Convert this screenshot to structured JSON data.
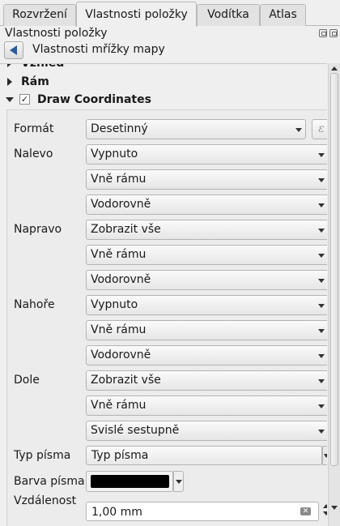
{
  "tabs": [
    {
      "label": "Rozvržení"
    },
    {
      "label": "Vlastnosti položky"
    },
    {
      "label": "Vodítka"
    },
    {
      "label": "Atlas"
    }
  ],
  "panel": {
    "title": "Vlastnosti položky",
    "back_label": "Vlastnosti mřížky mapy"
  },
  "groups": {
    "partial_label": "Vzhled",
    "frame_label": "Rám",
    "draw_coords_label": "Draw Coordinates",
    "draw_coords_checked": true,
    "checkmark": "✓"
  },
  "form": {
    "format_label": "Formát",
    "format_value": "Desetinný",
    "expression_symbol": "ε",
    "left_label": "Nalevo",
    "left_show": "Vypnuto",
    "left_position": "Vně rámu",
    "left_direction": "Vodorovně",
    "right_label": "Napravo",
    "right_show": "Zobrazit vše",
    "right_position": "Vně rámu",
    "right_direction": "Vodorovně",
    "top_label": "Nahoře",
    "top_show": "Vypnuto",
    "top_position": "Vně rámu",
    "top_direction": "Vodorovně",
    "bottom_label": "Dole",
    "bottom_show": "Zobrazit vše",
    "bottom_position": "Vně rámu",
    "bottom_direction": "Svislé sestupně",
    "font_label": "Typ písma",
    "font_value": "Typ písma",
    "font_color_label": "Barva písma",
    "font_color": "#000000",
    "distance_label": "Vzdálenost",
    "distance_value": "1,00 mm"
  }
}
